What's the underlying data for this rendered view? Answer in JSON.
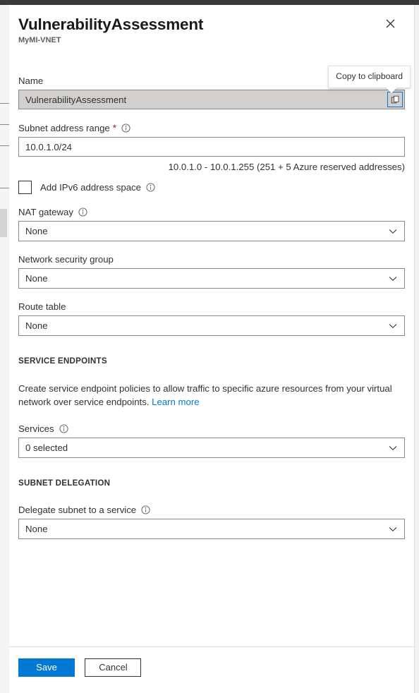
{
  "window": {
    "topbar_color": "#3b3a39"
  },
  "blade": {
    "title": "VulnerabilityAssessment",
    "subtitle": "MyMI-VNET",
    "close_icon": "close-icon"
  },
  "tooltip": {
    "copy_to_clipboard": "Copy to clipboard"
  },
  "form": {
    "name": {
      "label": "Name",
      "value": "VulnerabilityAssessment",
      "readonly": true,
      "copy_icon": "copy-icon"
    },
    "subnet_address_range": {
      "label": "Subnet address range",
      "required_marker": "*",
      "value": "10.0.1.0/24",
      "helper": "10.0.1.0 - 10.0.1.255 (251 + 5 Azure reserved addresses)",
      "info_icon": "info-icon"
    },
    "add_ipv6": {
      "label": "Add IPv6 address space",
      "checked": false,
      "info_icon": "info-icon"
    },
    "nat_gateway": {
      "label": "NAT gateway",
      "value": "None",
      "info_icon": "info-icon",
      "chevron_icon": "chevron-down-icon"
    },
    "network_security_group": {
      "label": "Network security group",
      "value": "None",
      "chevron_icon": "chevron-down-icon"
    },
    "route_table": {
      "label": "Route table",
      "value": "None",
      "chevron_icon": "chevron-down-icon"
    }
  },
  "service_endpoints": {
    "header": "SERVICE ENDPOINTS",
    "description": "Create service endpoint policies to allow traffic to specific azure resources from your virtual network over service endpoints.",
    "learn_more": "Learn more",
    "services": {
      "label": "Services",
      "value": "0 selected",
      "info_icon": "info-icon",
      "chevron_icon": "chevron-down-icon"
    }
  },
  "subnet_delegation": {
    "header": "SUBNET DELEGATION",
    "delegate": {
      "label": "Delegate subnet to a service",
      "value": "None",
      "info_icon": "info-icon",
      "chevron_icon": "chevron-down-icon"
    }
  },
  "footer": {
    "save_label": "Save",
    "cancel_label": "Cancel"
  },
  "colors": {
    "accent": "#0078d4",
    "required": "#a4262c",
    "link": "#0078d4",
    "readonly_bg": "#d2d0ce",
    "border": "#8a8886"
  }
}
